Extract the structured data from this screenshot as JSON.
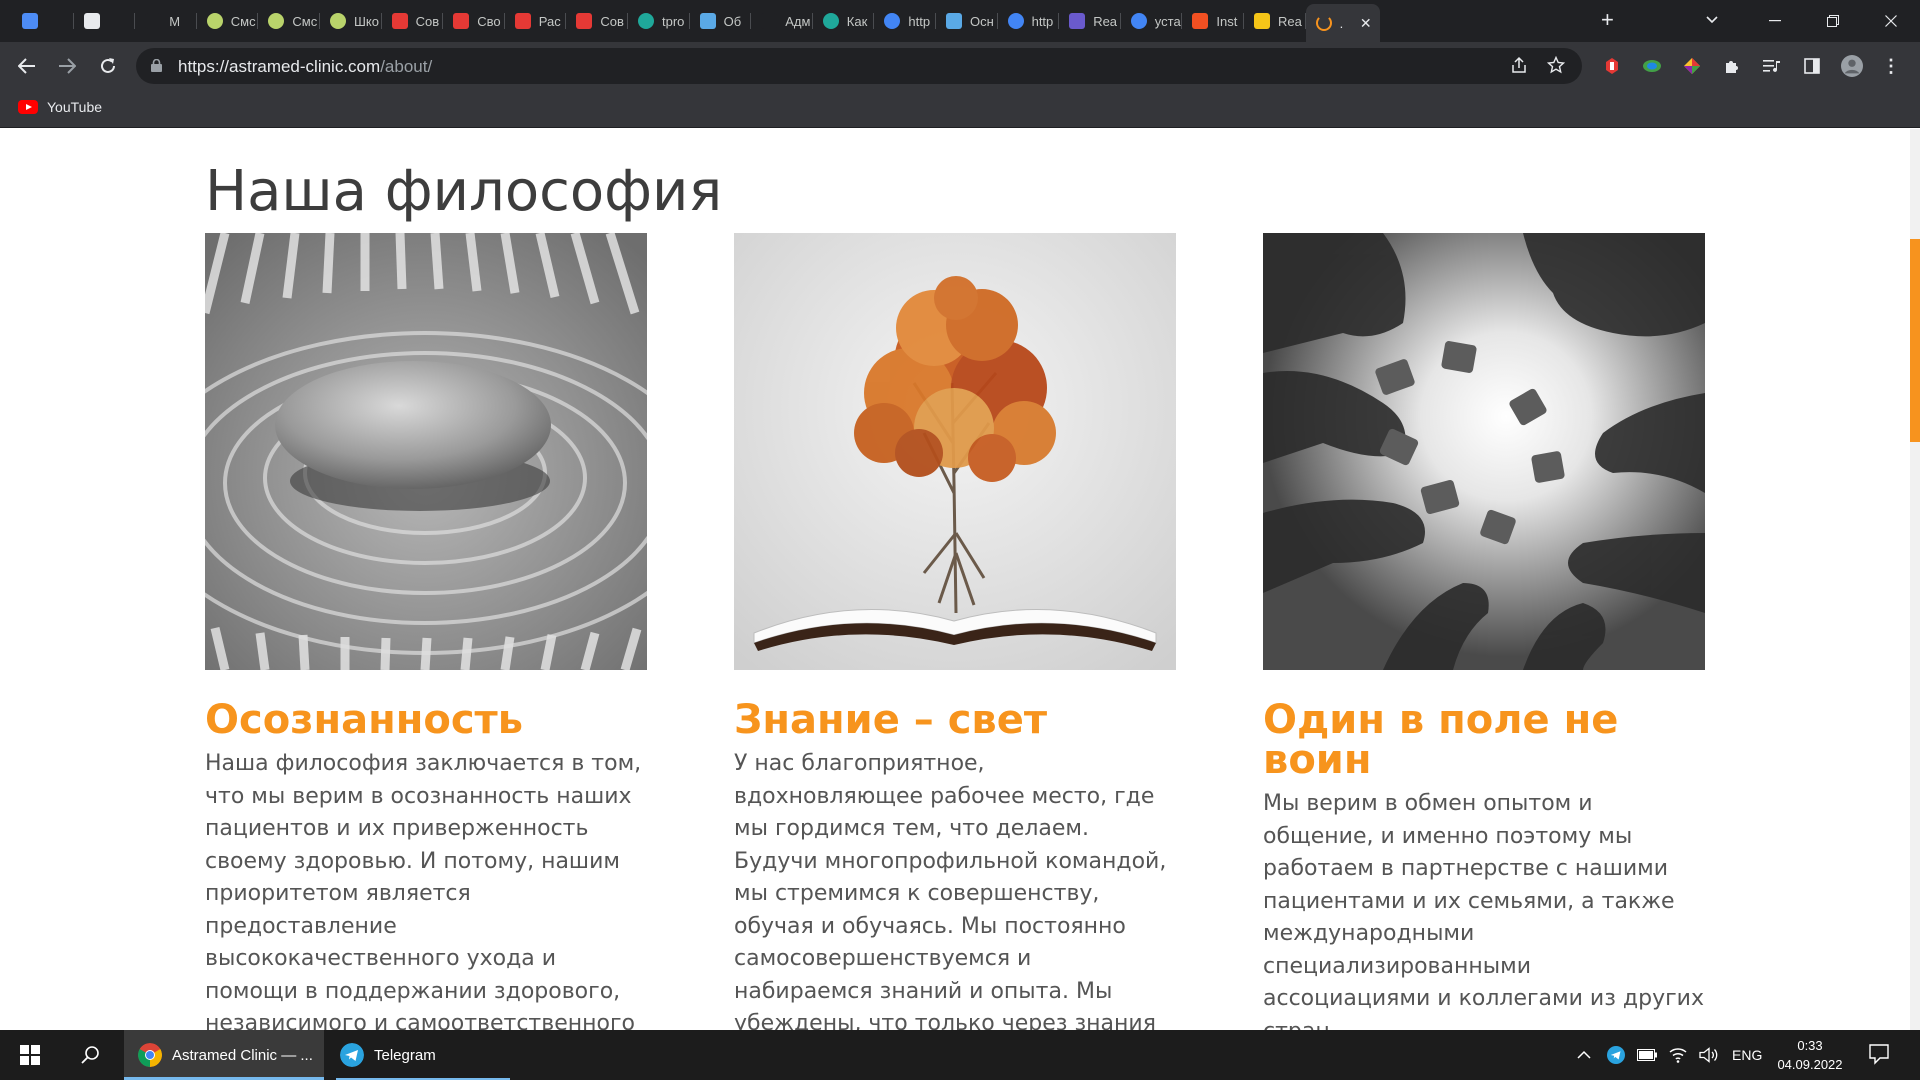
{
  "browser": {
    "tabs": [
      {
        "label": "",
        "icon": "u-icon",
        "color": "#4d8cf5"
      },
      {
        "label": "",
        "icon": "mask-icon",
        "color": "#e8eaed"
      },
      {
        "label": "M",
        "icon": "m-icon",
        "color": "#202124"
      },
      {
        "label": "Смс",
        "icon": "ball-icon",
        "color": "#b9d36b"
      },
      {
        "label": "Смс",
        "icon": "ball-icon",
        "color": "#b9d36b"
      },
      {
        "label": "Шко",
        "icon": "ball-icon",
        "color": "#b9d36b"
      },
      {
        "label": "Сов",
        "icon": "figure-icon",
        "color": "#e53935"
      },
      {
        "label": "Сво",
        "icon": "figure-icon",
        "color": "#e53935"
      },
      {
        "label": "Рас",
        "icon": "figure-icon",
        "color": "#e53935"
      },
      {
        "label": "Сов",
        "icon": "figure-icon",
        "color": "#e53935"
      },
      {
        "label": "tpro",
        "icon": "globe-icon",
        "color": "#1fa89a"
      },
      {
        "label": "Об",
        "icon": "star-icon",
        "color": "#5aa9e6"
      },
      {
        "label": "Адм",
        "icon": "on-icon",
        "color": "#202124"
      },
      {
        "label": "Как",
        "icon": "globe-icon",
        "color": "#1fa89a"
      },
      {
        "label": "http",
        "icon": "google-icon",
        "color": "#4285f4"
      },
      {
        "label": "Осн",
        "icon": "star-icon",
        "color": "#5aa9e6"
      },
      {
        "label": "http",
        "icon": "google-icon",
        "color": "#4285f4"
      },
      {
        "label": "Rea",
        "icon": "floppy-icon",
        "color": "#6a5acd"
      },
      {
        "label": "уста",
        "icon": "google-icon",
        "color": "#4285f4"
      },
      {
        "label": "Inst",
        "icon": "windows-icon",
        "color": "#f25022"
      },
      {
        "label": "Rea",
        "icon": "hex-icon",
        "color": "#f5c518"
      },
      {
        "label": ".",
        "icon": "loading-icon",
        "color": "#f7931e",
        "active": true
      }
    ],
    "url_host": "https://astramed-clinic.com",
    "url_path": "/about/",
    "bookmarks": [
      {
        "label": "YouTube",
        "icon": "youtube-icon"
      }
    ]
  },
  "page": {
    "heading": "Наша философия",
    "accent_color": "#f7941d",
    "columns": [
      {
        "title": "Осознанность",
        "image": "zen-stone-image",
        "text": "Наша философия заключается в том, что мы верим в осознанность наших пациентов и их приверженность своему здоровью. И потому, нашим приоритетом является предоставление высококачественного ухода и помощи в поддержании здорового, независимого и самоответственного сообщества."
      },
      {
        "title": "Знание – свет",
        "image": "tree-book-image",
        "text": "У нас благоприятное, вдохновляющее рабочее место, где мы гордимся тем, что делаем. Будучи многопрофильной командой, мы стремимся к совершенству, обучая и обучаясь. Мы постоянно самосовершенствуемся и набираемся знаний и опыта. Мы убеждены, что только через знания мы сможем принести наибольшую пользу"
      },
      {
        "title": "Один в поле не воин",
        "image": "puzzle-hands-image",
        "text": "Мы верим в обмен опытом и общение, и именно поэтому мы работаем в партнерстве с нашими пациентами и их семьями, а также международными специализированными ассоциациями и коллегами из других стран."
      }
    ]
  },
  "taskbar": {
    "apps": [
      {
        "label": "Astramed Clinic — ...",
        "icon": "chrome-icon",
        "active": true
      },
      {
        "label": "Telegram",
        "icon": "telegram-icon",
        "active": false
      }
    ],
    "language": "ENG",
    "time": "0:33",
    "date": "04.09.2022"
  }
}
